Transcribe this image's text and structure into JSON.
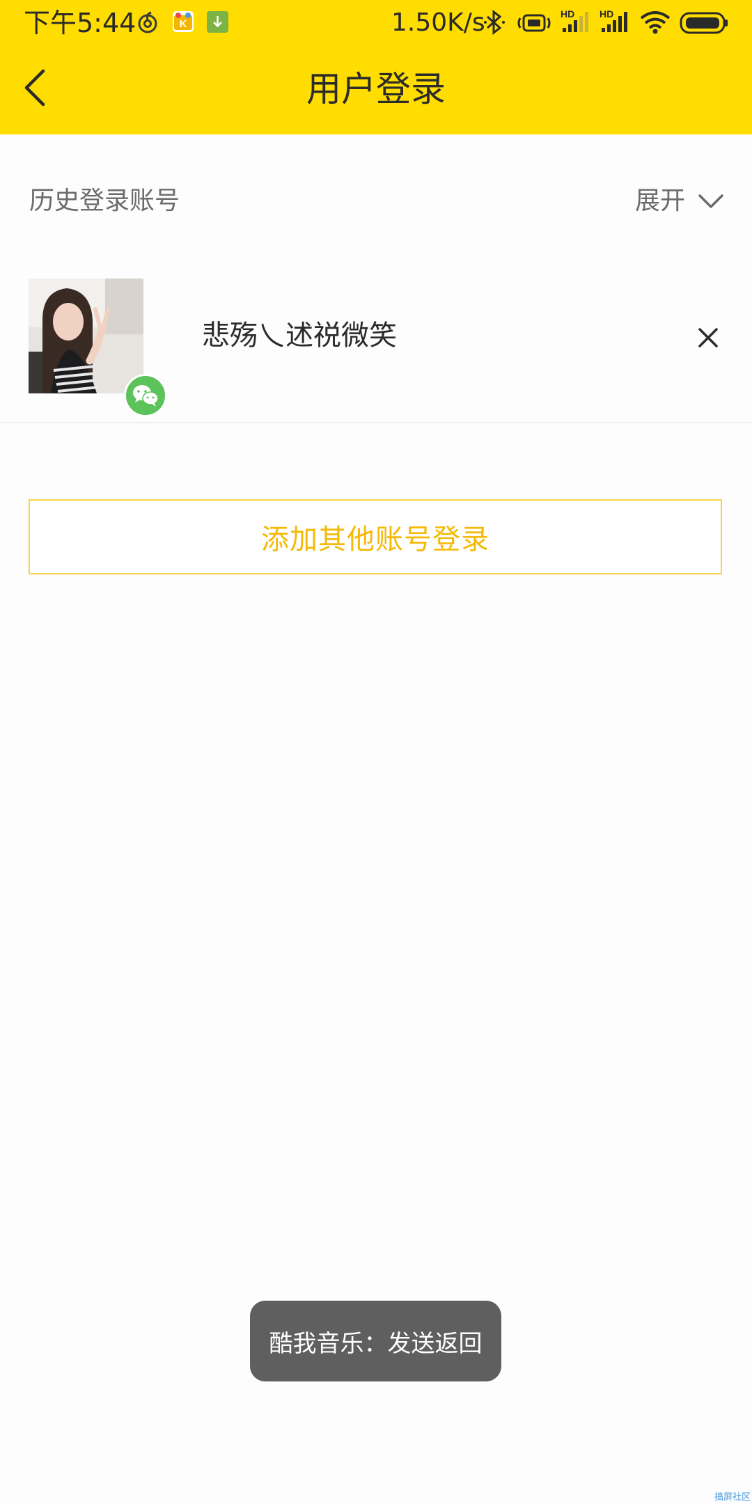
{
  "status_bar": {
    "time": "下午5:44",
    "network_speed": "1.50K/s",
    "signal_1_label": "HD",
    "signal_2_label": "HD",
    "icons": [
      "netease-music-icon",
      "app-k-icon",
      "download-icon",
      "bluetooth-icon",
      "vibrate-icon",
      "signal-icon",
      "signal-icon",
      "wifi-icon",
      "battery-icon"
    ]
  },
  "nav": {
    "title": "用户登录",
    "back_icon": "chevron-left-icon"
  },
  "history": {
    "title": "历史登录账号",
    "expand_label": "展开",
    "expand_icon": "chevron-down-icon"
  },
  "accounts": [
    {
      "name": "悲殇乀述祱微笑",
      "login_type_icon": "wechat-icon",
      "remove_icon": "close-icon"
    }
  ],
  "add_account": {
    "label": "添加其他账号登录"
  },
  "toast": {
    "text": "酷我音乐：发送返回"
  },
  "watermark": "搞屏社区",
  "colors": {
    "header_bg": "#ffdd00",
    "accent": "#f5b908",
    "wechat_green": "#5cc25a",
    "toast_bg": "#5f5f5f"
  }
}
